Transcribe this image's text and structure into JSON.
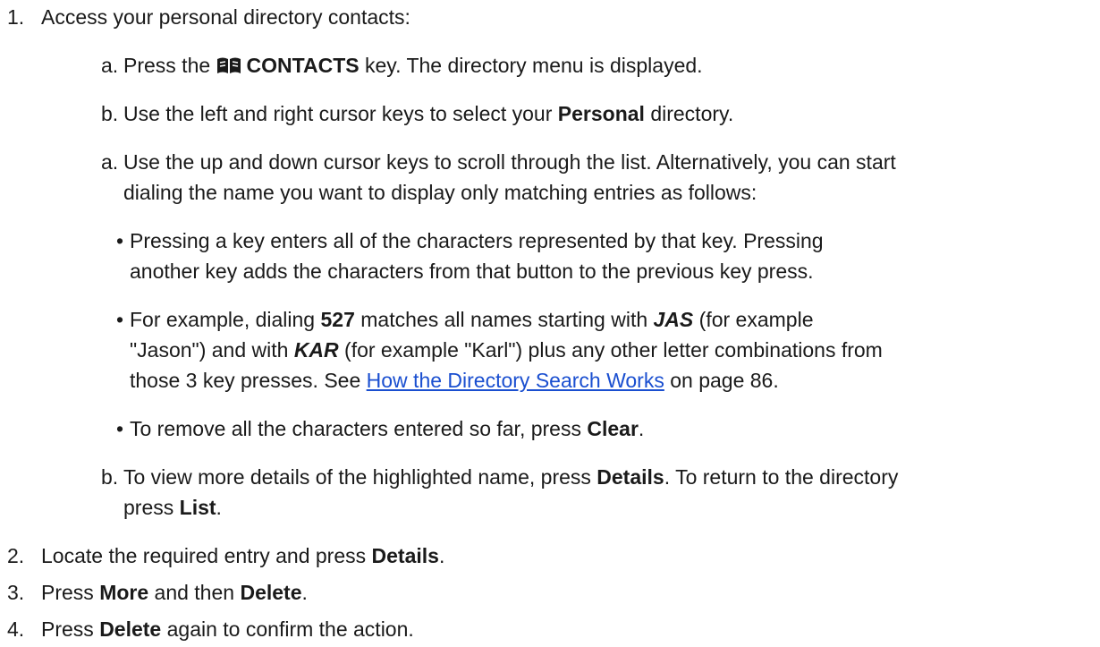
{
  "steps": [
    {
      "num": "1.",
      "text": "Access your personal directory contacts:"
    },
    {
      "num": "2.",
      "pre": "Locate the required entry and press ",
      "b1": "Details",
      "post": "."
    },
    {
      "num": "3.",
      "pre": "Press ",
      "b1": "More",
      "mid": " and then ",
      "b2": "Delete",
      "post": "."
    },
    {
      "num": "4.",
      "pre": "Press ",
      "b1": "Delete",
      "post": " again to confirm the action."
    }
  ],
  "substeps": {
    "a1": {
      "num": "a.",
      "pre": "Press the ",
      "icon": "book-icon",
      "b1": "CONTACTS",
      "post": " key. The directory menu is displayed."
    },
    "b1": {
      "num": "b.",
      "pre": "Use the left and right cursor keys to select your ",
      "b1": "Personal",
      "post": " directory."
    },
    "a2": {
      "num": "a.",
      "line1": "Use the up and down cursor keys to scroll through the list. Alternatively, you can start",
      "line2": "dialing the name you want to display only matching entries as follows:"
    },
    "b2": {
      "num": "b.",
      "pre": "To view more details of the highlighted name, press ",
      "b1": "Details",
      "mid": ". To return to the directory",
      "pre2": "press ",
      "b2": "List",
      "post": "."
    }
  },
  "bullets": {
    "glyph": "•",
    "p1": {
      "line1": "Pressing a key enters all of the characters represented by that key. Pressing",
      "line2": "another key adds the characters from that button to the previous key press."
    },
    "p2": {
      "l1_pre": "For example, dialing ",
      "l1_b": "527",
      "l1_mid": " matches all names starting with ",
      "l1_bi": "JAS",
      "l1_post": " (for example",
      "l2_pre": "\"Jason\") and with ",
      "l2_bi": "KAR",
      "l2_post": " (for example \"Karl\") plus any other letter combinations from",
      "l3_pre": "those 3 key presses. See ",
      "l3_link": "How the Directory Search Works",
      "l3_post": " on page 86."
    },
    "p3": {
      "pre": "To remove all the characters entered so far, press ",
      "b1": "Clear",
      "post": "."
    }
  },
  "colors": {
    "text": "#1a1a1a",
    "link": "#1a4fd0"
  }
}
